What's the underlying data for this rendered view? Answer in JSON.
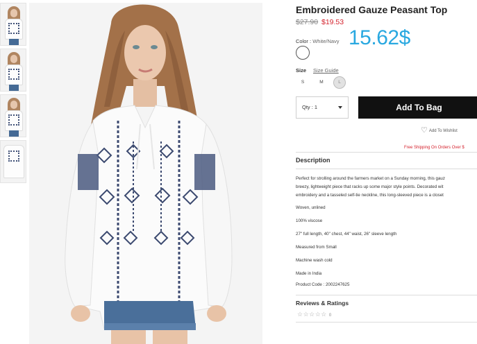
{
  "product": {
    "title": "Embroidered Gauze Peasant Top",
    "price_old": "$27.90",
    "price_new": "$19.53",
    "overlay_price": "15.62$"
  },
  "color": {
    "label": "Color",
    "separator": ":",
    "value": "White/Navy"
  },
  "size": {
    "label": "Size",
    "guide_label": "Size Guide",
    "options": [
      "S",
      "M",
      "L"
    ],
    "selected": "L"
  },
  "purchase": {
    "qty_label": "Qty : 1",
    "add_to_bag": "Add To Bag",
    "wishlist": "Add To Wishlist",
    "free_shipping": "Free Shipping On Orders Over $"
  },
  "description": {
    "title": "Description",
    "lines": [
      "Perfect for strolling around the farmers market on a Sunday morning, this gauz",
      "breezy, lightweight piece that racks up some major style points. Decorated wit",
      "embroidery and a tasseled self-tie neckline, this long-sleeved piece is a closet",
      "Woven, unlined",
      "100% viscose",
      "27\" full length, 40\" chest, 44\" waist, 26\" sleeve length",
      "Measured from Small",
      "Machine wash cold",
      "Made in India",
      "Product Code : 2002247625"
    ]
  },
  "reviews": {
    "title": "Reviews & Ratings",
    "stars": "☆☆☆☆☆",
    "count": "0"
  },
  "colors": {
    "accent_black": "#111111",
    "sale_red": "#d4222d",
    "overlay_blue": "#29a8e0"
  }
}
